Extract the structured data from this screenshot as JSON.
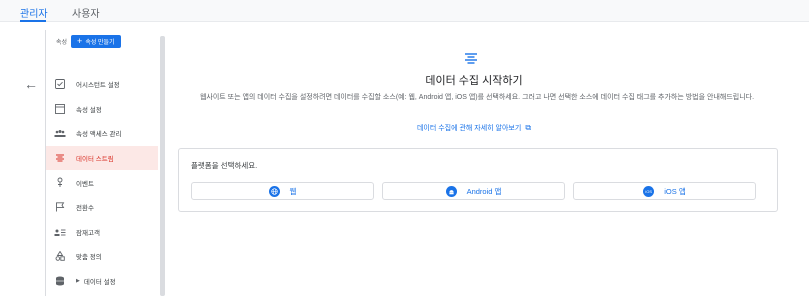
{
  "tabs": [
    {
      "label": "관리자",
      "active": true
    },
    {
      "label": "사용자",
      "active": false
    }
  ],
  "property": {
    "label": "속성",
    "create_button": "속성 만들기"
  },
  "menu": {
    "items": [
      {
        "label": "어시스턴트 설정",
        "icon": "checklist-icon"
      },
      {
        "label": "속성 설정",
        "icon": "window-icon"
      },
      {
        "label": "속성 액세스 관리",
        "icon": "people-icon"
      },
      {
        "label": "데이터 스트림",
        "icon": "streams-icon",
        "active": true
      },
      {
        "label": "이벤트",
        "icon": "events-icon"
      },
      {
        "label": "전환수",
        "icon": "flag-icon"
      },
      {
        "label": "잠재고객",
        "icon": "audience-icon"
      },
      {
        "label": "맞춤 정의",
        "icon": "shapes-icon"
      },
      {
        "label": "데이터 설정",
        "icon": "database-icon",
        "expandable": true
      }
    ]
  },
  "main": {
    "title": "데이터 수집 시작하기",
    "description": "웹사이트 또는 앱의 데이터 수집을 설정하려면 데이터를 수집할 소스(예: 웹, Android 앱, iOS 앱)를 선택하세요. 그러고 나면 선택한 소스에 데이터 수집 태그를 추가하는 방법을 안내해드립니다.",
    "learn_more": "데이터 수집에 관해 자세히 알아보기",
    "platform_prompt": "플랫폼을 선택하세요.",
    "platforms": [
      {
        "label": "웹",
        "icon": "web-icon"
      },
      {
        "label": "Android 앱",
        "icon": "android-icon"
      },
      {
        "label": "iOS 앱",
        "icon": "ios-icon",
        "icon_text": "iOS"
      }
    ]
  },
  "colors": {
    "accent": "#1a73e8",
    "active_item_bg": "#fce8e6",
    "active_item_text": "#d93025"
  }
}
